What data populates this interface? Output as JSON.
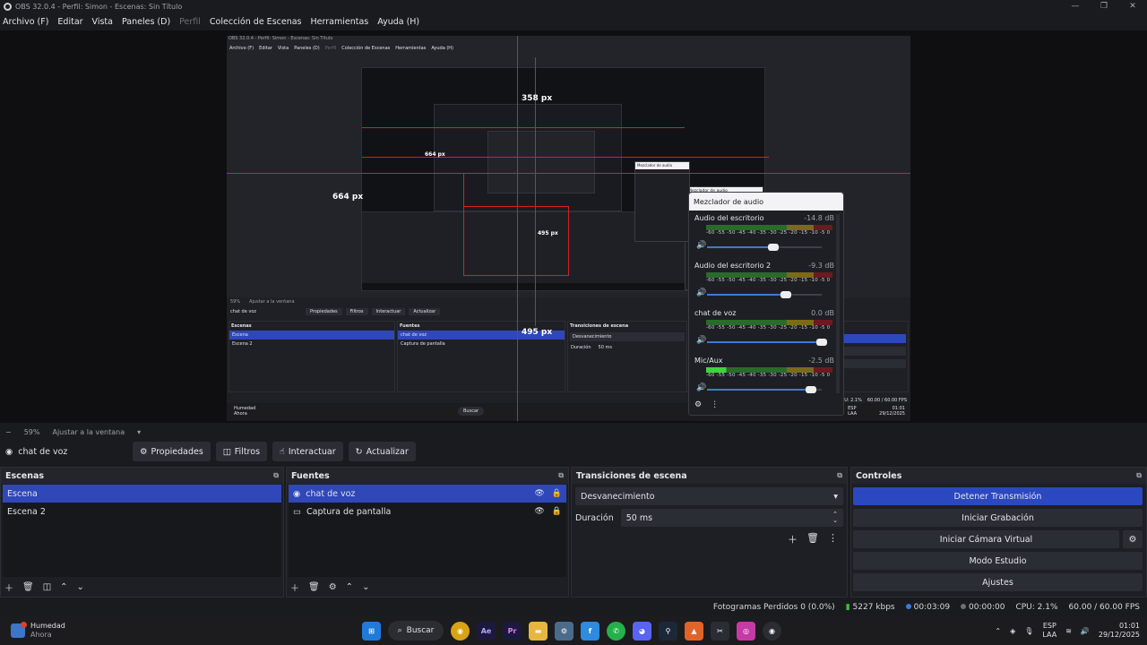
{
  "window": {
    "title": "OBS 32.0.4 - Perfil: Simon - Escenas: Sin Título",
    "controls": [
      "—",
      "❐",
      "✕"
    ]
  },
  "menubar": {
    "items": [
      "Archivo (F)",
      "Editar",
      "Vista",
      "Paneles (D)",
      "Perfil",
      "Colección de Escenas",
      "Herramientas",
      "Ayuda (H)"
    ]
  },
  "preview": {
    "labels": {
      "px358": "358 px",
      "px664a": "664 px",
      "px664b": "664 px",
      "px495a": "495 px",
      "px495b": "495 px"
    },
    "inner_title": "OBS 32.0.4 - Perfil: Simon - Escenas: Sin Título",
    "inner_menu": [
      "Archivo (F)",
      "Editar",
      "Vista",
      "Paneles (D)",
      "Perfil",
      "Colección de Escenas",
      "Herramientas",
      "Ayuda (H)"
    ],
    "inner_zoom": "59%",
    "inner_fit": "Ajustar a la ventana",
    "inner_source": "chat de voz",
    "inner_props": "Propiedades",
    "inner_filters": "Filtros",
    "inner_interact": "Interactuar",
    "inner_refresh": "Actualizar",
    "inner_scenes_title": "Escenas",
    "inner_scenes": [
      "Escena",
      "Escena 2"
    ],
    "inner_sources_title": "Fuentes",
    "inner_sources": [
      "chat de voz",
      "Captura de pantalla"
    ],
    "inner_trans_title": "Transiciones de escena",
    "inner_trans": "Desvanecimiento",
    "inner_dur_label": "Duración",
    "inner_dur": "50 ms",
    "inner_status": "CPU: 2.1%",
    "inner_fps": "60.00 / 60.00 FPS",
    "inner_weather": "Humedad",
    "inner_weather_sub": "Ahora",
    "inner_search": "Buscar",
    "inner_lang": "ESP",
    "inner_lang_sub": "LAA",
    "inner_time": "01:01",
    "inner_date": "29/12/2025",
    "mini_mixers": [
      {
        "title": "Mezclador de audio",
        "ch": "Audio del escritorio",
        "db": "-14.8 dB"
      },
      {
        "title": "Mezclador de audio",
        "ch": "Audio del escritorio 2",
        "db": ""
      }
    ]
  },
  "mixer": {
    "title": "Mezclador de audio",
    "channels": [
      {
        "name": "Audio del escritorio",
        "db": "-14.8 dB",
        "level": 0.6
      },
      {
        "name": "Audio del escritorio 2",
        "db": "-9.3 dB",
        "level": 0.7
      },
      {
        "name": "chat de voz",
        "db": "0.0 dB",
        "level": 1.0
      },
      {
        "name": "Mic/Aux",
        "db": "-2.5 dB",
        "level": 0.92
      }
    ],
    "scale": "-60 -55 -50 -45 -40 -35 -30 -25 -20 -15 -10 -5 0"
  },
  "zoombar": {
    "minus": "−",
    "zoom": "59%",
    "fit": "Ajustar a la ventana"
  },
  "sourcebar": {
    "current_source": "chat de voz",
    "buttons": [
      "Propiedades",
      "Filtros",
      "Interactuar",
      "Actualizar"
    ]
  },
  "scenes": {
    "title": "Escenas",
    "items": [
      "Escena",
      "Escena 2"
    ]
  },
  "sources": {
    "title": "Fuentes",
    "items": [
      "chat de voz",
      "Captura de pantalla"
    ]
  },
  "transitions": {
    "title": "Transiciones de escena",
    "selected": "Desvanecimiento",
    "duration_label": "Duración",
    "duration": "50 ms"
  },
  "controls": {
    "title": "Controles",
    "stop_stream": "Detener Transmisión",
    "start_recording": "Iniciar Grabación",
    "virtual_cam": "Iniciar Cámara Virtual",
    "studio_mode": "Modo Estudio",
    "settings": "Ajustes"
  },
  "status": {
    "dropped": "Fotogramas Perdidos 0 (0.0%)",
    "bitrate": "5227 kbps",
    "stream_time": "00:03:09",
    "rec_time": "00:00:00",
    "cpu": "CPU: 2.1%",
    "fps": "60.00 / 60.00 FPS"
  },
  "taskbar": {
    "weather_title": "Humedad",
    "weather_sub": "Ahora",
    "search": "Buscar",
    "lang": "ESP",
    "lang_sub": "LAA",
    "time": "01:01",
    "date": "29/12/2025"
  },
  "colors": {
    "accent": "#3047b8",
    "bg": "#1a1b1f",
    "redline": "#d82020"
  }
}
